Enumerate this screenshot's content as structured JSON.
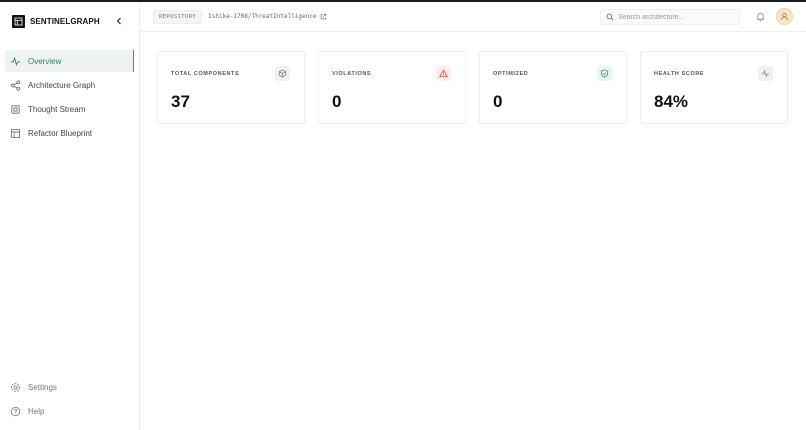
{
  "brand": {
    "name": "SENTINELGRAPH"
  },
  "sidebar": {
    "items": [
      {
        "label": "Overview",
        "icon": "activity-icon",
        "active": true
      },
      {
        "label": "Architecture Graph",
        "icon": "share-icon"
      },
      {
        "label": "Thought Stream",
        "icon": "cpu-icon"
      },
      {
        "label": "Refactor Blueprint",
        "icon": "layout-icon"
      }
    ],
    "bottom": [
      {
        "label": "Settings",
        "icon": "gear-icon"
      },
      {
        "label": "Help",
        "icon": "help-circle-icon"
      }
    ]
  },
  "header": {
    "repo_label": "REPOSITORY",
    "repo_path": "Ishika-1708/ThreatIntelligence",
    "search_placeholder": "Search architecture..."
  },
  "cards": [
    {
      "label": "TOTAL COMPONENTS",
      "value": "37",
      "icon": "cube-icon"
    },
    {
      "label": "VIOLATIONS",
      "value": "0",
      "icon": "alert-triangle-icon"
    },
    {
      "label": "OPTIMIZED",
      "value": "0",
      "icon": "shield-check-icon"
    },
    {
      "label": "HEALTH SCORE",
      "value": "84%",
      "icon": "activity-icon"
    }
  ],
  "colors": {
    "accent": "#2f9a6e",
    "danger": "#e04848",
    "success": "#2f9a6e"
  }
}
